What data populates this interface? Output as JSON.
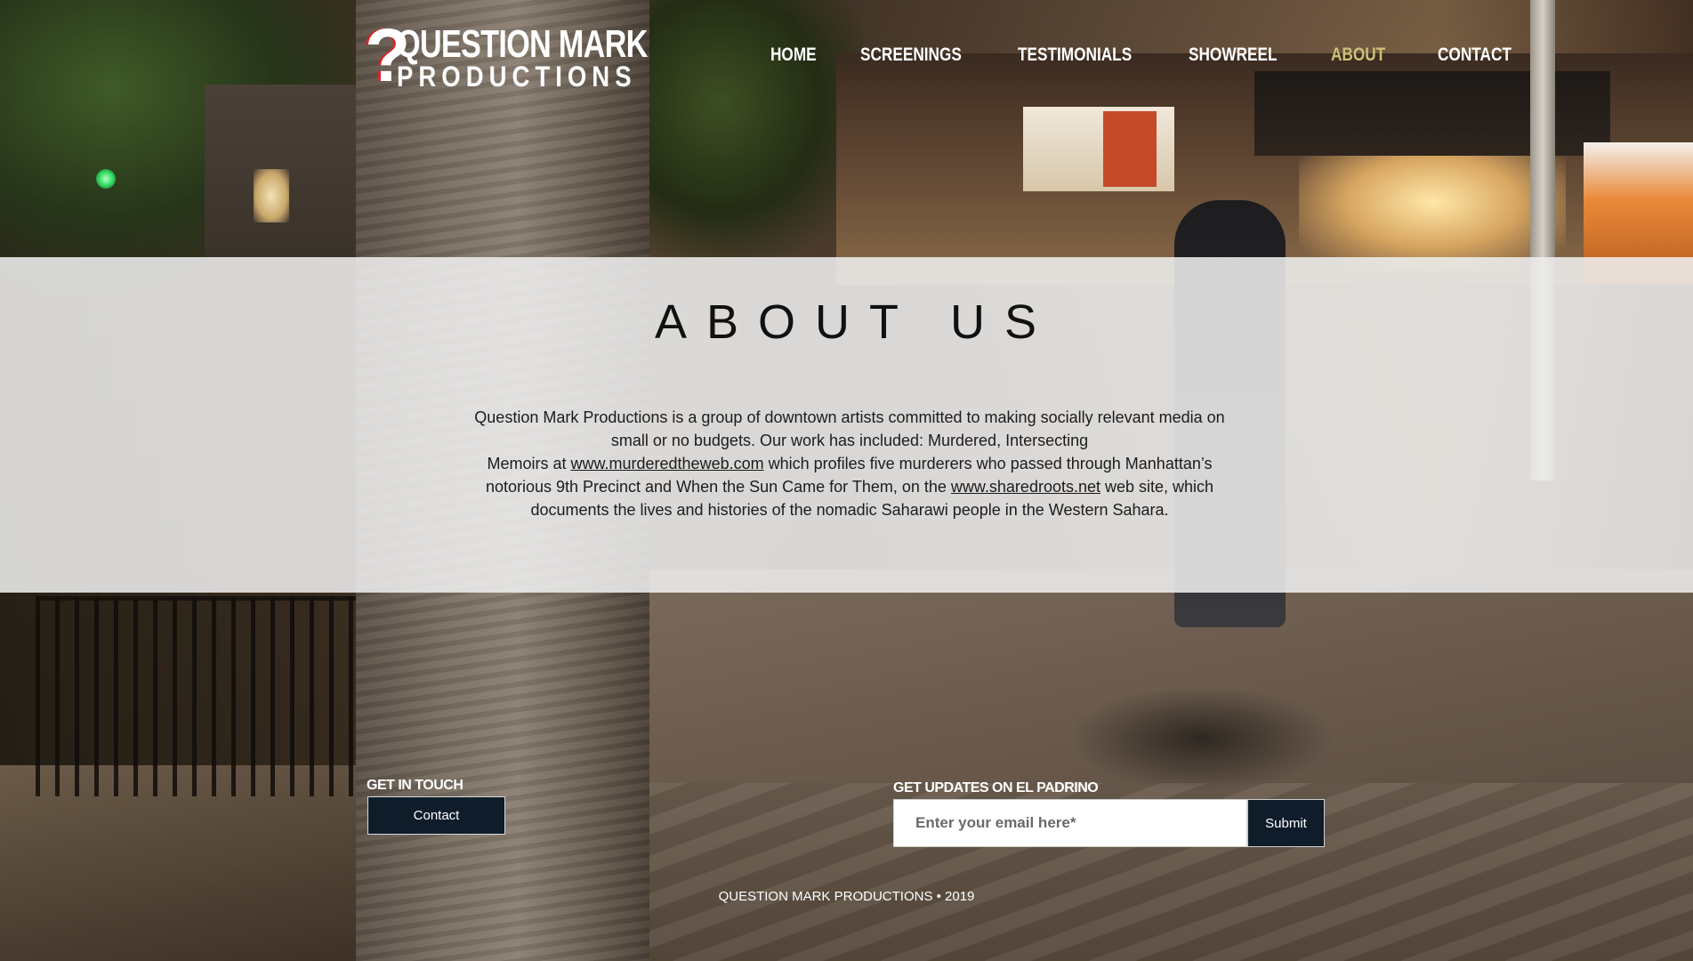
{
  "logo": {
    "mark": "?",
    "line1": "QUESTION MARK",
    "line2": "PRODUCTIONS"
  },
  "nav": {
    "items": [
      {
        "label": "HOME",
        "active": false
      },
      {
        "label": "SCREENINGS",
        "active": false
      },
      {
        "label": "TESTIMONIALS",
        "active": false
      },
      {
        "label": "SHOWREEL",
        "active": false
      },
      {
        "label": "ABOUT",
        "active": true
      },
      {
        "label": "CONTACT",
        "active": false
      }
    ],
    "active_color": "#cdbf7a"
  },
  "about": {
    "title": "ABOUT US",
    "body": {
      "p1": "Question Mark Productions is a group of downtown artists committed to making socially relevant media on small or no budgets. Our work has included: Murdered, Intersecting",
      "p2_before": "Memoirs at ",
      "link1": "www.murderedtheweb.com",
      "p2_middle": " which profiles five murderers who passed through Manhattan’s notorious 9th Precinct and When the Sun Came for Them, on the ",
      "link2": "www.sharedroots.net",
      "p2_after": " web site, which documents the lives and histories of the nomadic Saharawi people in the Western Sahara."
    }
  },
  "footer": {
    "get_in_touch_label": "GET IN TOUCH",
    "contact_button": "Contact",
    "updates_label": "GET UPDATES ON EL PADRINO",
    "email_placeholder": "Enter your email here*",
    "submit_button": "Submit",
    "copyright": "QUESTION MARK PRODUCTIONS • 2019"
  },
  "colors": {
    "button_bg": "#0f1d2b",
    "strip_bg": "#eeeeee"
  }
}
